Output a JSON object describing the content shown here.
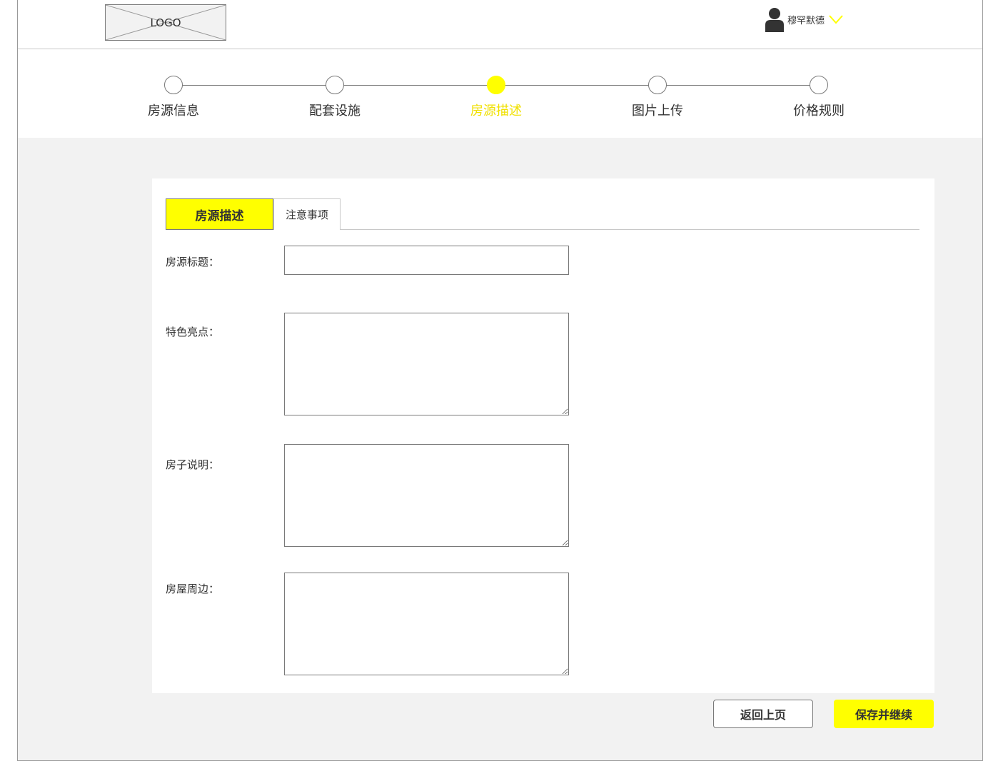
{
  "header": {
    "logo_text": "LOGO",
    "user_name": "穆罕默德",
    "accent_color": "#ffff00"
  },
  "steps": [
    {
      "label": "房源信息",
      "active": false
    },
    {
      "label": "配套设施",
      "active": false
    },
    {
      "label": "房源描述",
      "active": true
    },
    {
      "label": "图片上传",
      "active": false
    },
    {
      "label": "价格规则",
      "active": false
    }
  ],
  "tabs": [
    {
      "label": "房源描述",
      "active": true
    },
    {
      "label": "注意事项",
      "active": false
    }
  ],
  "form": {
    "title_label": "房源标题：",
    "title_value": "",
    "highlights_label": "特色亮点：",
    "highlights_value": "",
    "description_label": "房子说明：",
    "description_value": "",
    "surroundings_label": "房屋周边：",
    "surroundings_value": ""
  },
  "actions": {
    "back_label": "返回上页",
    "save_label": "保存并继续"
  }
}
